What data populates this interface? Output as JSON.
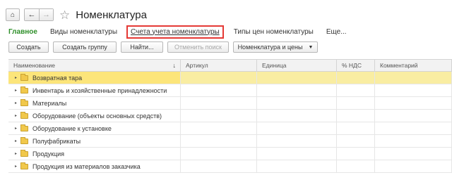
{
  "header": {
    "home_icon": "home-icon",
    "back_icon": "arrow-left-icon",
    "forward_icon": "arrow-right-icon",
    "favorite_icon": "star-icon",
    "title": "Номенклатура"
  },
  "tabs": [
    {
      "label": "Главное"
    },
    {
      "label": "Виды номенклатуры"
    },
    {
      "label": "Счета учета номенклатуры"
    },
    {
      "label": "Типы цен номенклатуры"
    },
    {
      "label": "Еще..."
    }
  ],
  "toolbar": {
    "create": "Создать",
    "create_group": "Создать группу",
    "find": "Найти...",
    "cancel_search": "Отменить поиск",
    "nomenclature_prices": "Номенклатура и цены"
  },
  "columns": [
    "Наименование",
    "Артикул",
    "Единица",
    "% НДС",
    "Комментарий"
  ],
  "rows": [
    {
      "name": "Возвратная тара"
    },
    {
      "name": "Инвентарь и хозяйственные принадлежности"
    },
    {
      "name": "Материалы"
    },
    {
      "name": "Оборудование (объекты основных средств)"
    },
    {
      "name": "Оборудование к установке"
    },
    {
      "name": "Полуфабрикаты"
    },
    {
      "name": "Продукция"
    },
    {
      "name": "Продукция из материалов заказчика"
    }
  ],
  "colors": {
    "active_tab": "#2e8f29",
    "highlight_border": "#e53935",
    "selected_row": "#f9eda2"
  }
}
